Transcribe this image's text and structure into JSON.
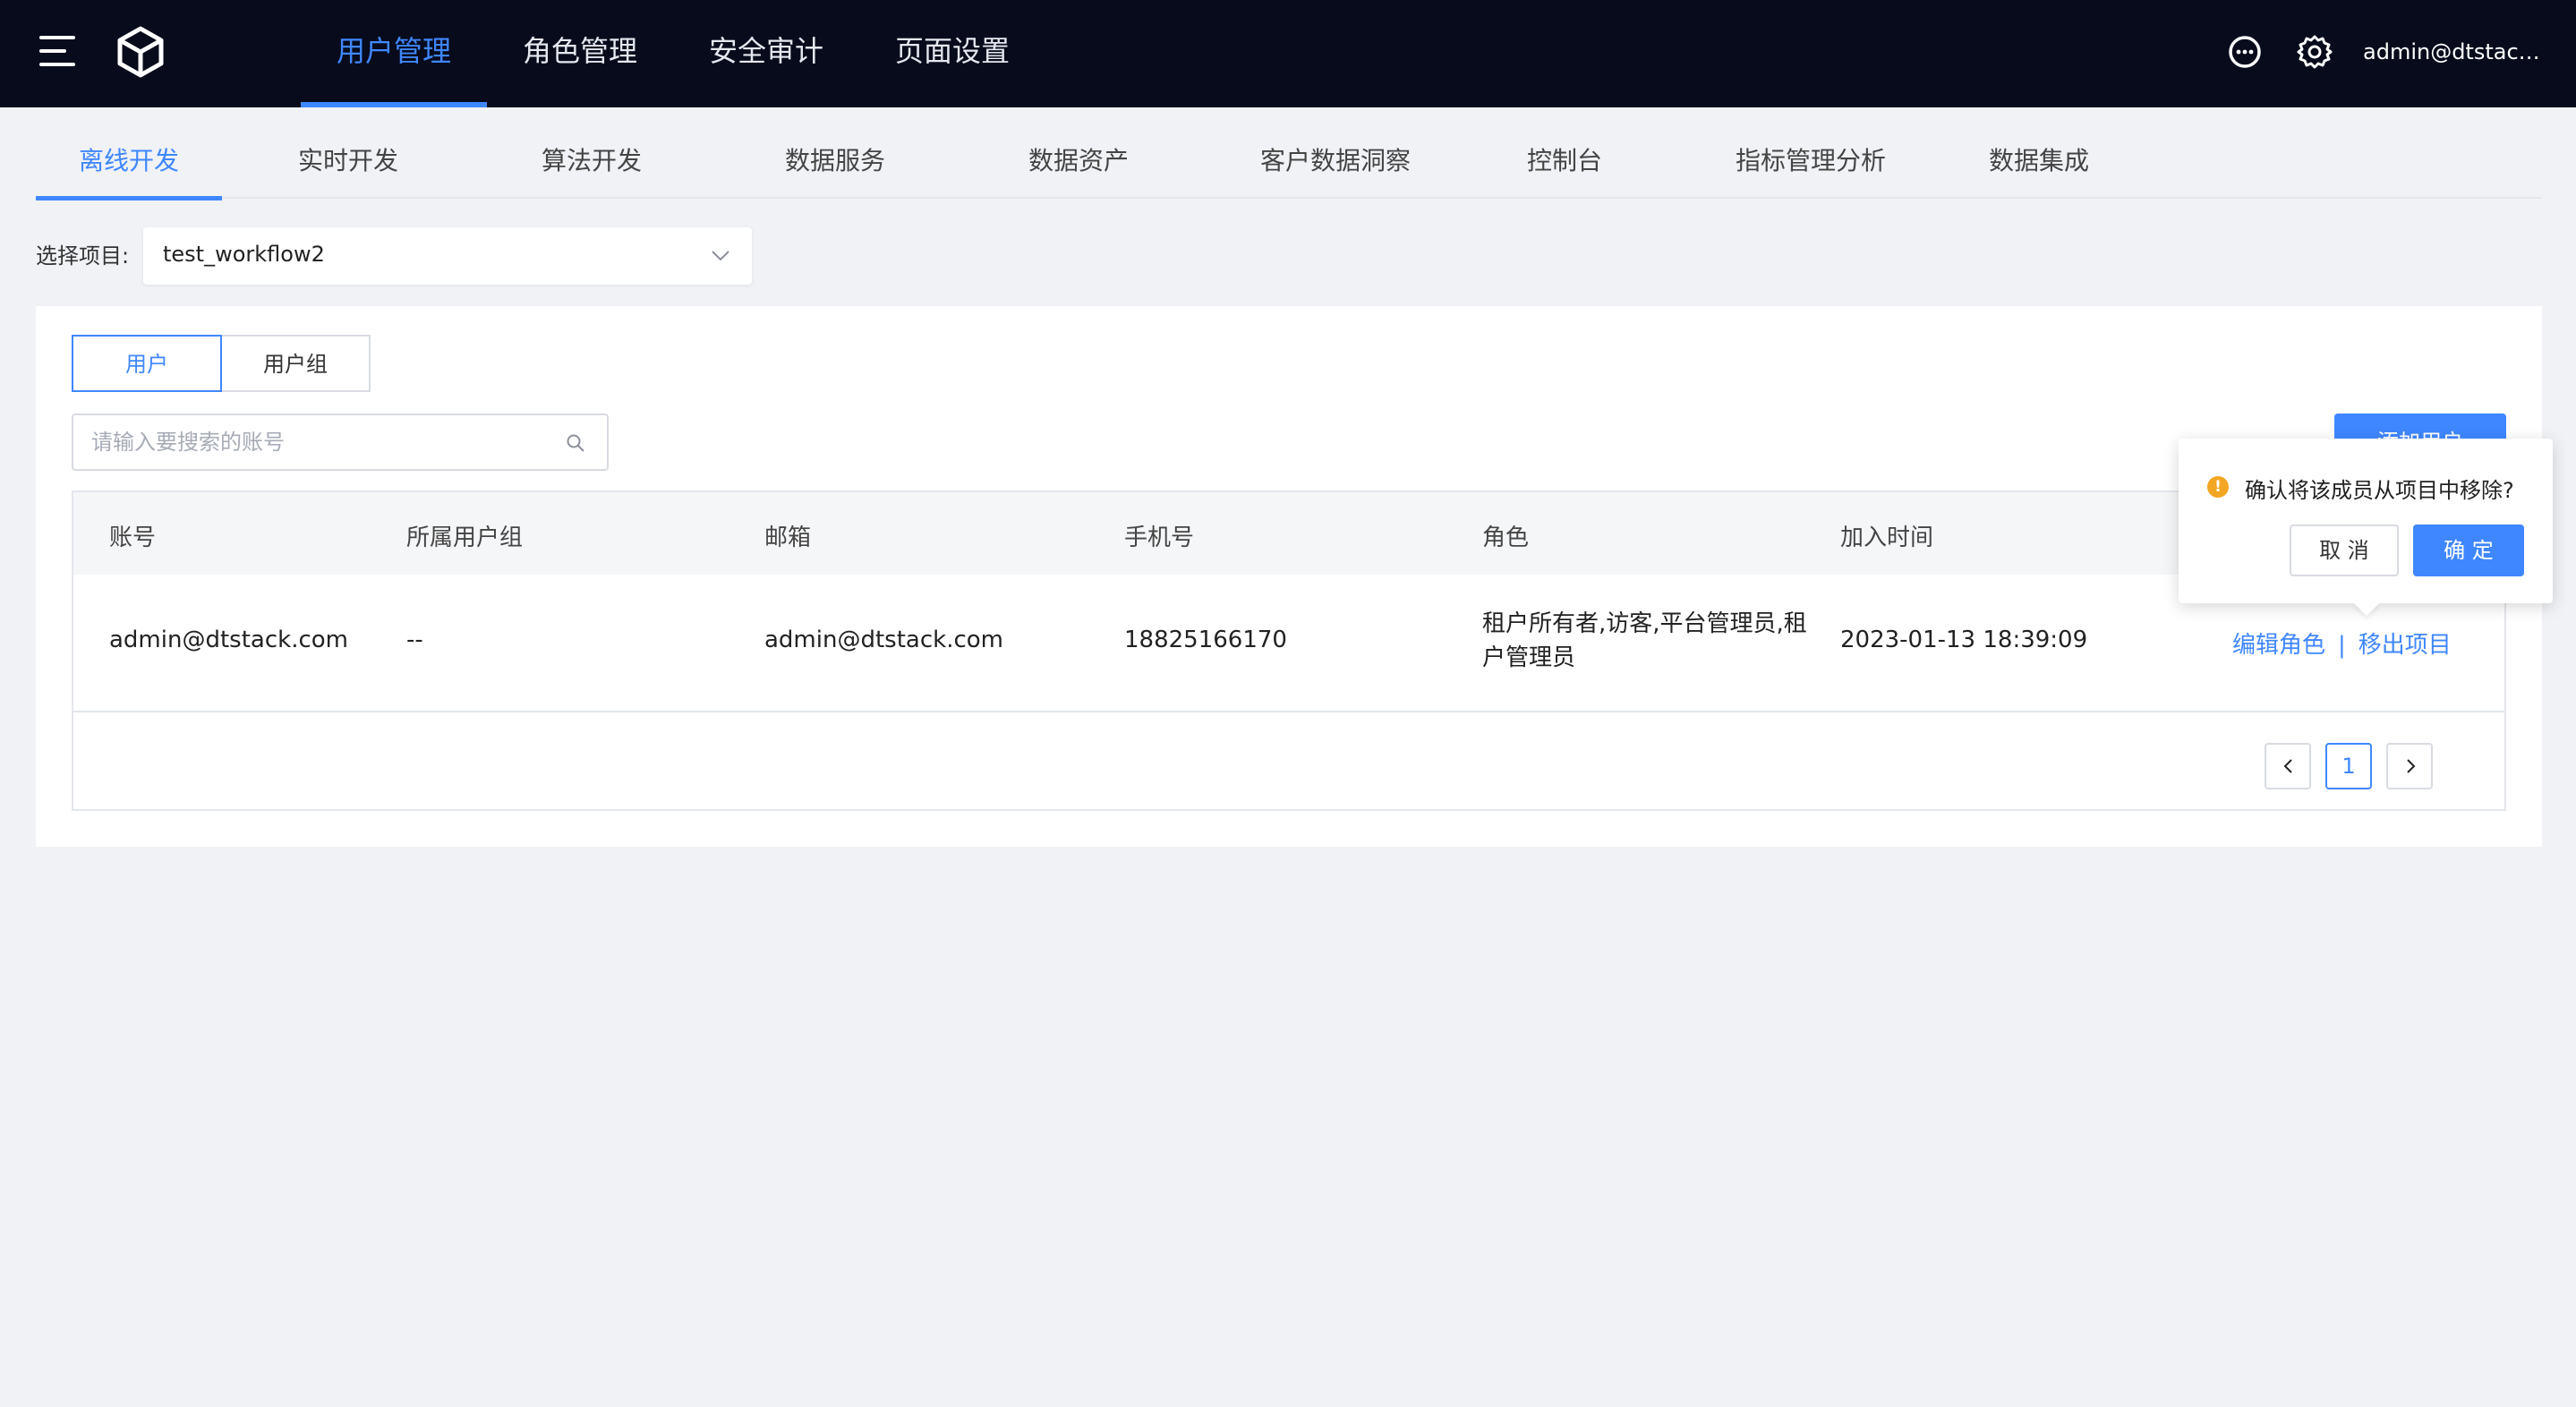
{
  "header": {
    "nav": [
      {
        "label": "用户管理",
        "active": true
      },
      {
        "label": "角色管理",
        "active": false
      },
      {
        "label": "安全审计",
        "active": false
      },
      {
        "label": "页面设置",
        "active": false
      }
    ],
    "user": "admin@dtstack...",
    "icons": [
      "menu-icon",
      "cube-logo-icon",
      "chat-bubble-icon",
      "gear-icon"
    ]
  },
  "subtabs": [
    {
      "label": "离线开发",
      "active": true
    },
    {
      "label": "实时开发",
      "active": false
    },
    {
      "label": "算法开发",
      "active": false
    },
    {
      "label": "数据服务",
      "active": false
    },
    {
      "label": "数据资产",
      "active": false
    },
    {
      "label": "客户数据洞察",
      "active": false
    },
    {
      "label": "控制台",
      "active": false
    },
    {
      "label": "指标管理分析",
      "active": false
    },
    {
      "label": "数据集成",
      "active": false
    }
  ],
  "project": {
    "label": "选择项目:",
    "value": "test_workflow2"
  },
  "segment": [
    {
      "label": "用户",
      "active": true
    },
    {
      "label": "用户组",
      "active": false
    }
  ],
  "search": {
    "placeholder": "请输入要搜索的账号",
    "value": ""
  },
  "add_button": "添加用户",
  "table": {
    "columns": [
      "账号",
      "所属用户组",
      "邮箱",
      "手机号",
      "角色",
      "加入时间"
    ],
    "rows": [
      {
        "account": "admin@dtstack.com",
        "group": "--",
        "email": "admin@dtstack.com",
        "phone": "18825166170",
        "roles": "租户所有者,访客,平台管理员,租户管理员",
        "joined": "2023-01-13 18:39:09",
        "actions": {
          "edit": "编辑角色",
          "separator": "|",
          "remove": "移出项目"
        }
      }
    ]
  },
  "pagination": {
    "current": "1"
  },
  "popconfirm": {
    "message": "确认将该成员从项目中移除?",
    "cancel": "取 消",
    "ok": "确 定"
  },
  "colors": {
    "accent": "#3f87ff",
    "header_bg": "#070b1c",
    "page_bg": "#f0f2f6",
    "warning": "#f2a623"
  }
}
